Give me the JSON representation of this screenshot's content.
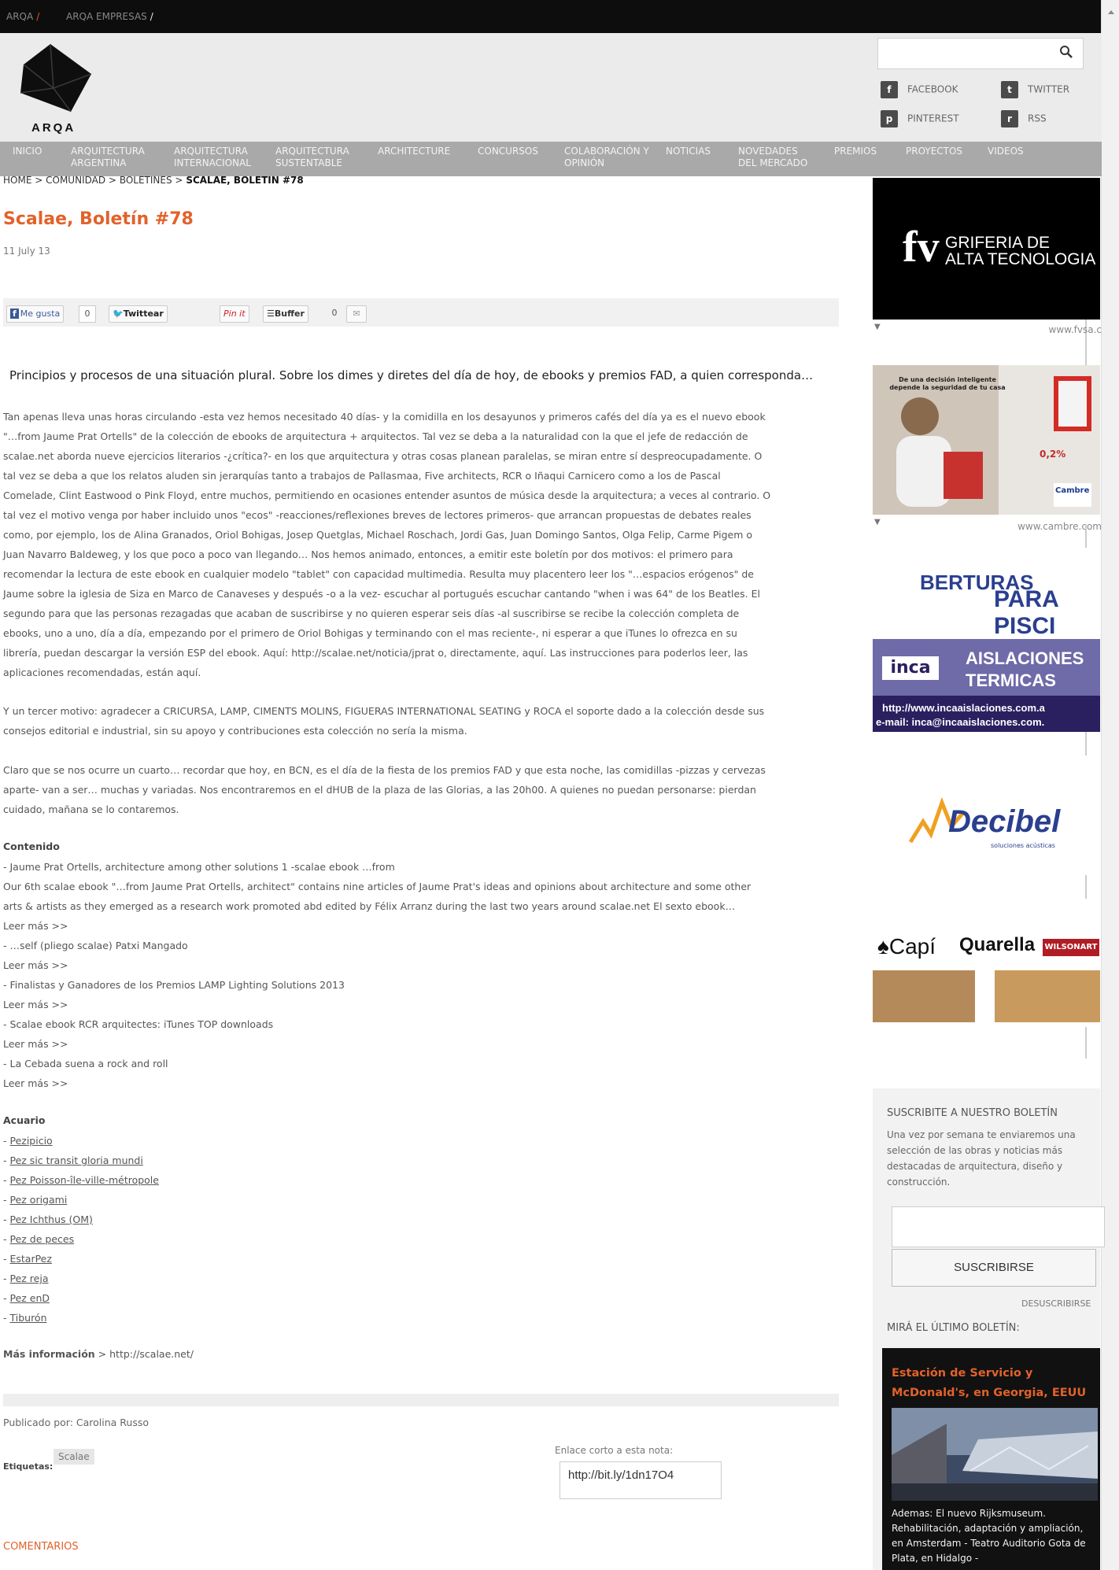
{
  "topbar": {
    "links": [
      "ARQA",
      "ARQA EMPRESAS"
    ]
  },
  "brand": {
    "logo_text": "ARQA"
  },
  "search": {
    "placeholder": "",
    "button_icon": "search-icon"
  },
  "social": [
    {
      "label": "FACEBOOK",
      "icon": "facebook-icon",
      "glyph": "f"
    },
    {
      "label": "TWITTER",
      "icon": "twitter-icon",
      "glyph": "t"
    },
    {
      "label": "PINTEREST",
      "icon": "pinterest-icon",
      "glyph": "p"
    },
    {
      "label": "RSS",
      "icon": "rss-icon",
      "glyph": "r"
    }
  ],
  "nav": [
    "INICIO",
    "ARQUITECTURA ARGENTINA",
    "ARQUITECTURA INTERNACIONAL",
    "ARQUITECTURA SUSTENTABLE",
    "ARCHITECTURE",
    "CONCURSOS",
    "COLABORACIÓN Y OPINIÓN",
    "NOTICIAS",
    "NOVEDADES DEL MERCADO",
    "PREMIOS",
    "PROYECTOS",
    "VIDEOS"
  ],
  "breadcrumb": {
    "home": "HOME",
    "community": "COMUNIDAD",
    "bulletins": "BOLETINES",
    "current": "SCALAE, BOLETIN #78",
    "sep": ">"
  },
  "article": {
    "title": "Scalae, Boletín #78",
    "date": "11 July 13",
    "share": {
      "like": "Me gusta",
      "like_count": "0",
      "tweet": "Twittear",
      "pin": "Pin it",
      "buffer": "Buffer",
      "buffer_count": "0"
    },
    "lead": "Principios y procesos de una situación plural. Sobre los dimes y diretes del día de hoy, de ebooks y premios FAD, a quien corresponda…",
    "p1": [
      "Tan apenas lleva unas horas circulando -esta vez hemos necesitado 40 días- y la comidilla en los desayunos y primeros cafés del día ya es el nuevo ebook",
      "\"…from Jaume Prat Ortells\" de la colección de ebooks de arquitectura + arquitectos. Tal vez se deba a la naturalidad con la que el jefe de redacción de",
      "scalae.net aborda nueve ejercicios literarios -¿crítica?- en los que arquitectura y otras cosas planean paralelas, se miran entre sí despreocupadamente. O",
      "tal vez se deba a que los relatos aluden sin jerarquías tanto a trabajos de Pallasmaa, Five architects, RCR o Iñaqui Carnicero como a los de Pascal",
      "Comelade, Clint Eastwood o Pink Floyd, entre muchos, permitiendo en ocasiones entender asuntos de música desde la arquitectura; a veces al contrario. O",
      "tal vez el motivo venga por haber incluido unos \"ecos\" -reacciones/reflexiones breves de lectores primeros- que arrancan propuestas de debates reales",
      "como, por ejemplo, los de Alina Granados, Oriol Bohigas, Josep Quetglas, Michael Roschach, Jordi Gas, Juan Domingo Santos, Olga Felip, Carme Pigem o",
      "Juan Navarro Baldeweg, y los que poco a poco van llegando… Nos hemos animado, entonces, a emitir este boletín por dos motivos: el primero para",
      "recomendar la lectura de este ebook en cualquier modelo \"tablet\" con capacidad multimedia. Resulta muy placentero leer los \"…espacios erógenos\" de",
      "Jaume sobre la iglesia de Siza en Marco de Canaveses y después -o a la vez- escuchar al portugués escuchar cantando \"when i was 64\" de los Beatles. El",
      "segundo para que las personas rezagadas que acaban de suscribirse y no quieren esperar seis días -al suscribirse se recibe la colección completa de",
      "ebooks, uno a uno, día a día, empezando por el primero de Oriol Bohigas y terminando con el mas reciente-, ni esperar a que iTunes lo ofrezca en su",
      "librería, puedan descargar la versión ESP del ebook. Aquí: http://scalae.net/noticia/jprat o, directamente, aquí. Las instrucciones para poderlos leer, las",
      "aplicaciones recomendadas, están aquí."
    ],
    "p2": [
      "Y un tercer motivo: agradecer a CRICURSA, LAMP, CIMENTS MOLINS, FIGUERAS INTERNATIONAL SEATING y ROCA el soporte dado a la colección desde sus",
      "consejos editorial e industrial, sin su apoyo y contribuciones esta colección no sería la misma."
    ],
    "p3": [
      "Claro que se nos ocurre un cuarto… recordar que hoy, en BCN, es el día de la fiesta de los premios FAD y que esta noche, las comidillas -pizzas y cervezas",
      "aparte- van a ser… muchas y variadas. Nos encontraremos en el dHUB de la plaza de las Glorias, a las 20h00. A quienes no puedan personarse: pierdan",
      "cuidado, mañana se lo contaremos."
    ],
    "contenido_title": "Contenido",
    "contenido": [
      "- Jaume Prat Ortells, architecture among other solutions 1 -scalae ebook …from",
      "Our 6th scalae ebook \"…from Jaume Prat Ortells, architect\" contains nine articles of Jaume Prat's ideas and opinions about architecture and some other",
      "arts & artists as they emerged as a research work promoted abd edited by Félix Arranz during the last two years around scalae.net El sexto ebook…",
      "Leer más >>",
      "- …self (pliego scalae) Patxi Mangado",
      "Leer más >>",
      "- Finalistas y Ganadores de los Premios LAMP Lighting Solutions 2013",
      "Leer más >>",
      "- Scalae ebook RCR arquitectes: iTunes TOP downloads",
      "Leer más >>",
      "- La Cebada suena a rock and roll",
      "Leer más >>"
    ],
    "acuario_title": "Acuario",
    "acuario": [
      "Pezipicio",
      "Pez sic transit gloria mundi",
      "Pez Poisson-île-ville-métropole",
      "Pez origami",
      "Pez Ichthus (OM)",
      "Pez de peces",
      "EstarPez",
      "Pez reja",
      "Pez enD",
      "Tiburón"
    ],
    "mas_info_label": "Más información",
    "mas_info_link": "> http://scalae.net/",
    "publicado": "Publicado por: Carolina Russo",
    "etiquetas_label": "Etiquetas:",
    "tag": "Scalae",
    "enlace_label": "Enlace corto a esta nota:",
    "enlace_value": "http://bit.ly/1dn17O4",
    "comentarios": "COMENTARIOS"
  },
  "ads": {
    "fv_text_1": "GRIFERIA DE",
    "fv_text_2": "ALTA TECNOLOGIA",
    "fv_logo": "fv",
    "fv_url": "www.fvsa.c",
    "cambre_headline": "De una decisión inteligente depende la seguridad de tu casa",
    "cambre_stat": "0,2%",
    "cambre_brand": "Cambre",
    "cambre_url": "www.cambre.com",
    "piscinas_1": "BERTURAS",
    "piscinas_2": "PARA PISCI",
    "inca_logo": "inca",
    "inca_1": "AISLACIONES",
    "inca_2": "TERMICAS",
    "inca_web": "http://www.incaaislaciones.com.a",
    "inca_mail": "e-mail: inca@incaaislaciones.com.",
    "decibel": "Decibel",
    "decibel_sub": "soluciones acústicas",
    "brands": [
      "Capí",
      "Quarella",
      "WILSONART"
    ]
  },
  "newsletter": {
    "title": "SUSCRIBITE A NUESTRO BOLETÍN",
    "description": "Una vez por semana te enviaremos una selección de las obras y noticias más destacadas de arquitectura, diseño y construcción.",
    "email_placeholder": "",
    "button": "SUSCRIBIRSE",
    "unsubscribe": "DESUSCRIBIRSE",
    "last_title": "MIRÁ EL ÚLTIMO BOLETÍN:",
    "last_headline": "Estación de Servicio y McDonald's, en Georgia, EEUU",
    "last_body": "Ademas: El nuevo Rijksmuseum. Rehabilitación, adaptación y ampliación, en Amsterdam - Teatro Auditorio Gota de Plata, en Hidalgo -"
  },
  "colors": {
    "accent": "#e2622a",
    "nav_bg": "#a9a9a9",
    "header_bg": "#ebebeb"
  }
}
